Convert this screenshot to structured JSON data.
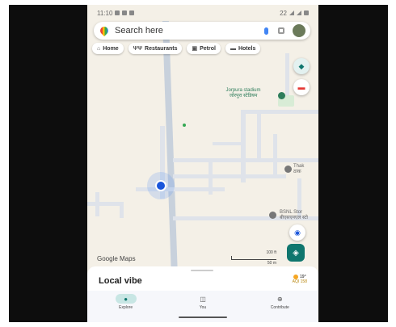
{
  "status_bar": {
    "time": "11:10",
    "right_text": "22"
  },
  "search": {
    "placeholder": "Search here"
  },
  "chips": [
    {
      "icon": "home-icon",
      "glyph": "⌂",
      "label": "Home"
    },
    {
      "icon": "restaurant-icon",
      "glyph": "ΨΨ",
      "label": "Restaurants"
    },
    {
      "icon": "fuel-icon",
      "glyph": "▣",
      "label": "Petrol"
    },
    {
      "icon": "hotel-icon",
      "glyph": "▬",
      "label": "Hotels"
    }
  ],
  "map": {
    "labels": {
      "stadium": "Jorpura stadium",
      "stadium_sub": "जोरपुरा स्टेडियम",
      "thak": "Thak",
      "thak_sub": "ठाक",
      "bsnl": "BSNL Stor",
      "bsnl_sub": "बीएसएनएल स्टो"
    },
    "brand": "Google Maps",
    "scale_ft": "100 ft",
    "scale_m": "50 m"
  },
  "sheet": {
    "title": "Local vibe",
    "temperature": "19°",
    "aqi": "AQI 158"
  },
  "nav": [
    {
      "id": "explore",
      "icon": "pin-icon",
      "glyph": "●",
      "label": "Explore",
      "active": true
    },
    {
      "id": "you",
      "icon": "bookmark-icon",
      "glyph": "◫",
      "label": "You",
      "active": false
    },
    {
      "id": "contribute",
      "icon": "plus-icon",
      "glyph": "⊕",
      "label": "Contribute",
      "active": false
    }
  ],
  "colors": {
    "accent": "#0f766e",
    "location_dot": "#1a56db",
    "map_bg": "#f4f0e7"
  }
}
